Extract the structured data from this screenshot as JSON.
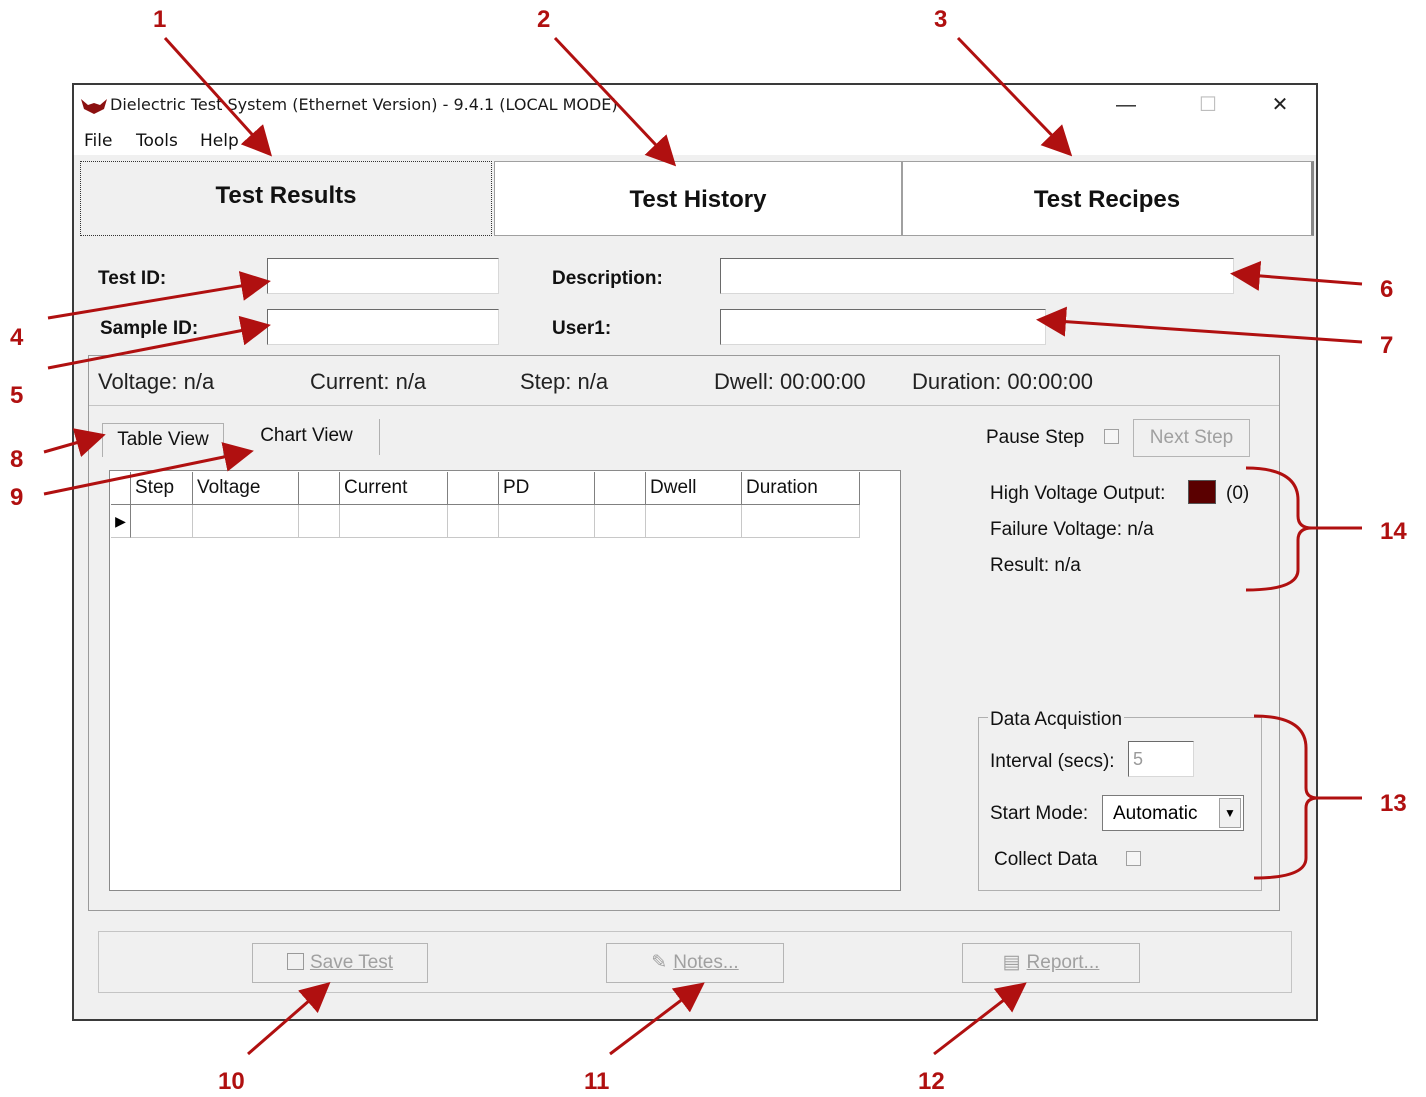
{
  "window": {
    "title": "Dielectric Test System (Ethernet Version) - 9.4.1  (LOCAL MODE)",
    "minimize": "—",
    "maximize": "☐",
    "close": "✕"
  },
  "menu": [
    "File",
    "Tools",
    "Help"
  ],
  "main_tabs": [
    "Test Results",
    "Test History",
    "Test Recipes"
  ],
  "form": {
    "test_id_label": "Test ID:",
    "test_id_value": "",
    "sample_id_label": "Sample ID:",
    "sample_id_value": "",
    "description_label": "Description:",
    "description_value": "",
    "user1_label": "User1:",
    "user1_value": ""
  },
  "status": {
    "voltage": "Voltage: n/a",
    "current": "Current: n/a",
    "step": "Step: n/a",
    "dwell": "Dwell: 00:00:00",
    "duration": "Duration:  00:00:00"
  },
  "view_tabs": [
    "Table View",
    "Chart View"
  ],
  "grid": {
    "columns": [
      "Step",
      "Voltage",
      "",
      "Current",
      "",
      "PD",
      "",
      "Dwell",
      "Duration"
    ],
    "row_marker": "▶"
  },
  "controls": {
    "pause_step": "Pause Step",
    "next_step": "Next Step"
  },
  "output": {
    "hv_label": "High Voltage Output:",
    "hv_count": "(0)",
    "hv_color": "#5a0000",
    "failure_voltage": "Failure Voltage: n/a",
    "result": "Result:  n/a"
  },
  "acquisition": {
    "legend": "Data Acquistion",
    "interval_label": "Interval (secs):",
    "interval_value": "5",
    "start_mode_label": "Start Mode:",
    "start_mode_value": "Automatic",
    "collect_data": "Collect Data"
  },
  "buttons": {
    "save": "Save Test",
    "notes": "Notes...",
    "report": "Report..."
  },
  "annotations": [
    "1",
    "2",
    "3",
    "4",
    "5",
    "6",
    "7",
    "8",
    "9",
    "10",
    "11",
    "12",
    "13",
    "14"
  ],
  "colors": {
    "annotation": "#b01010"
  }
}
